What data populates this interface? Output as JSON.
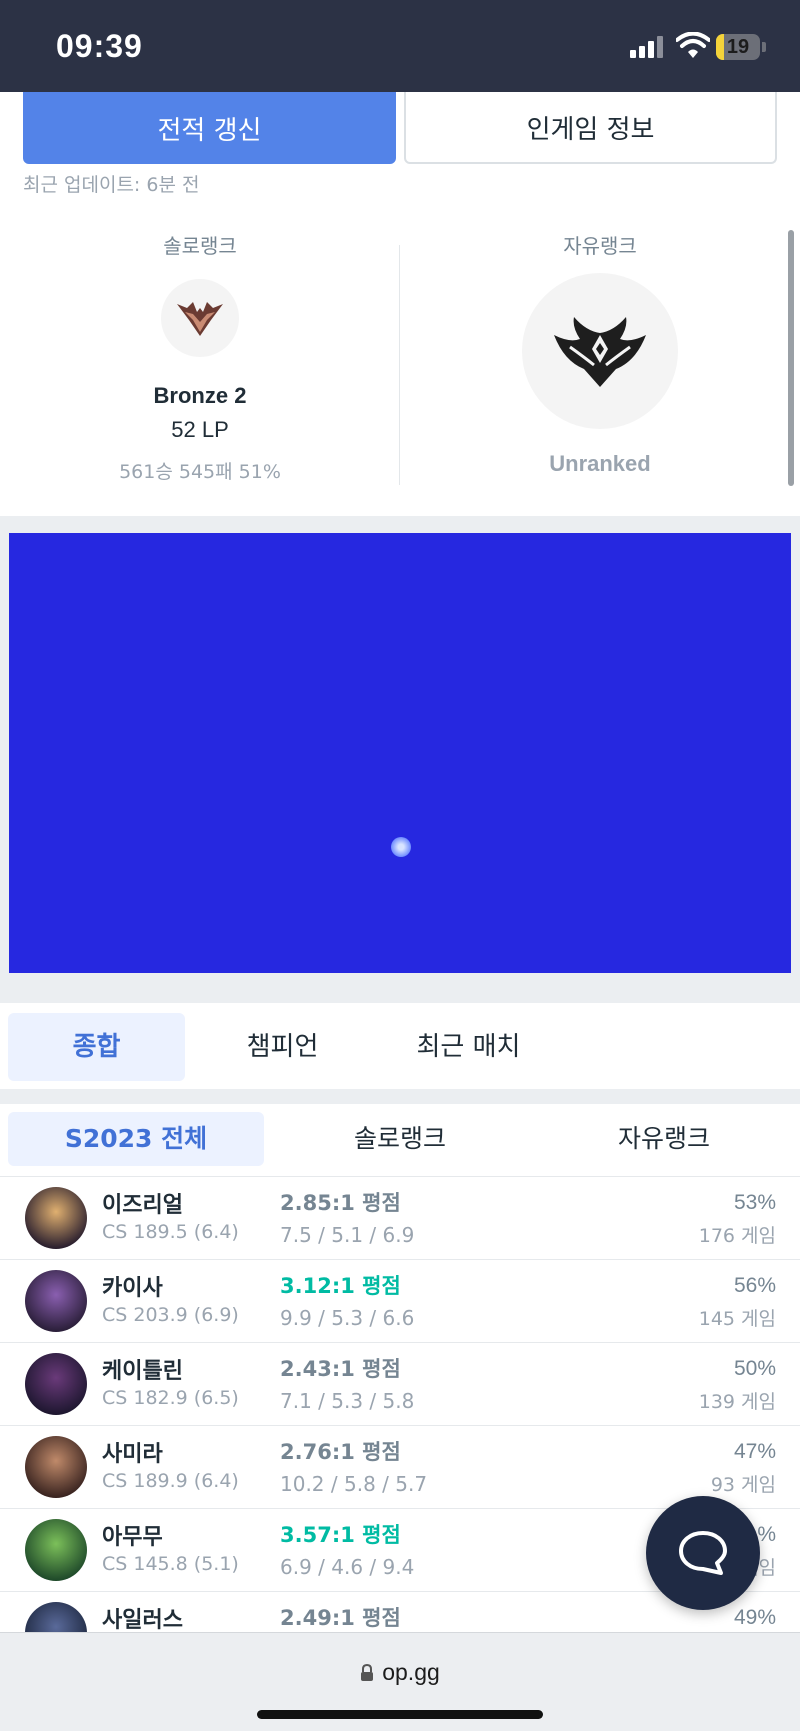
{
  "status_bar": {
    "time": "09:39",
    "battery": "19",
    "battery_level": 0.19
  },
  "header_buttons": {
    "refresh": "전적 갱신",
    "ingame": "인게임 정보",
    "last_update": "최근 업데이트: 6분 전"
  },
  "ranks": {
    "solo": {
      "title": "솔로랭크",
      "tier": "Bronze 2",
      "lp": "52 LP",
      "record": "561승 545패 51%"
    },
    "flex": {
      "title": "자유랭크",
      "status": "Unranked"
    }
  },
  "tabs": [
    {
      "label": "종합"
    },
    {
      "label": "챔피언"
    },
    {
      "label": "최근 매치"
    }
  ],
  "season_tabs": [
    {
      "label": "S2023 전체"
    },
    {
      "label": "솔로랭크"
    },
    {
      "label": "자유랭크"
    }
  ],
  "champions": [
    {
      "name": "이즈리얼",
      "cs": "CS 189.5 (6.4)",
      "kda": "2.85:1 평점",
      "stats": "7.5 / 5.1 / 6.9",
      "winrate": "53%",
      "games": "176 게임",
      "highlight": false
    },
    {
      "name": "카이사",
      "cs": "CS 203.9 (6.9)",
      "kda": "3.12:1 평점",
      "stats": "9.9 / 5.3 / 6.6",
      "winrate": "56%",
      "games": "145 게임",
      "highlight": true
    },
    {
      "name": "케이틀린",
      "cs": "CS 182.9 (6.5)",
      "kda": "2.43:1 평점",
      "stats": "7.1 / 5.3 / 5.8",
      "winrate": "50%",
      "games": "139 게임",
      "highlight": false
    },
    {
      "name": "사미라",
      "cs": "CS 189.9 (6.4)",
      "kda": "2.76:1 평점",
      "stats": "10.2 / 5.8 / 5.7",
      "winrate": "47%",
      "games": "93 게임",
      "highlight": false
    },
    {
      "name": "아무무",
      "cs": "CS 145.8 (5.1)",
      "kda": "3.57:1 평점",
      "stats": "6.9 / 4.6 / 9.4",
      "winrate": "%",
      "games": "게임",
      "highlight": true
    },
    {
      "name": "사일러스",
      "cs": "",
      "kda": "2.49:1 평점",
      "stats": "",
      "winrate": "49%",
      "games": "",
      "highlight": false
    }
  ],
  "url_bar": {
    "url": "op.gg"
  },
  "colors": {
    "accent": "#5383e8",
    "green_kda": "#00bba3",
    "ad_blue": "#2628e0",
    "status_bar": "#2c3245"
  },
  "icons": [
    "signal-icon",
    "wifi-icon",
    "battery-icon",
    "bronze-emblem-icon",
    "unranked-emblem-icon",
    "chat-bubble-icon",
    "lock-icon"
  ]
}
